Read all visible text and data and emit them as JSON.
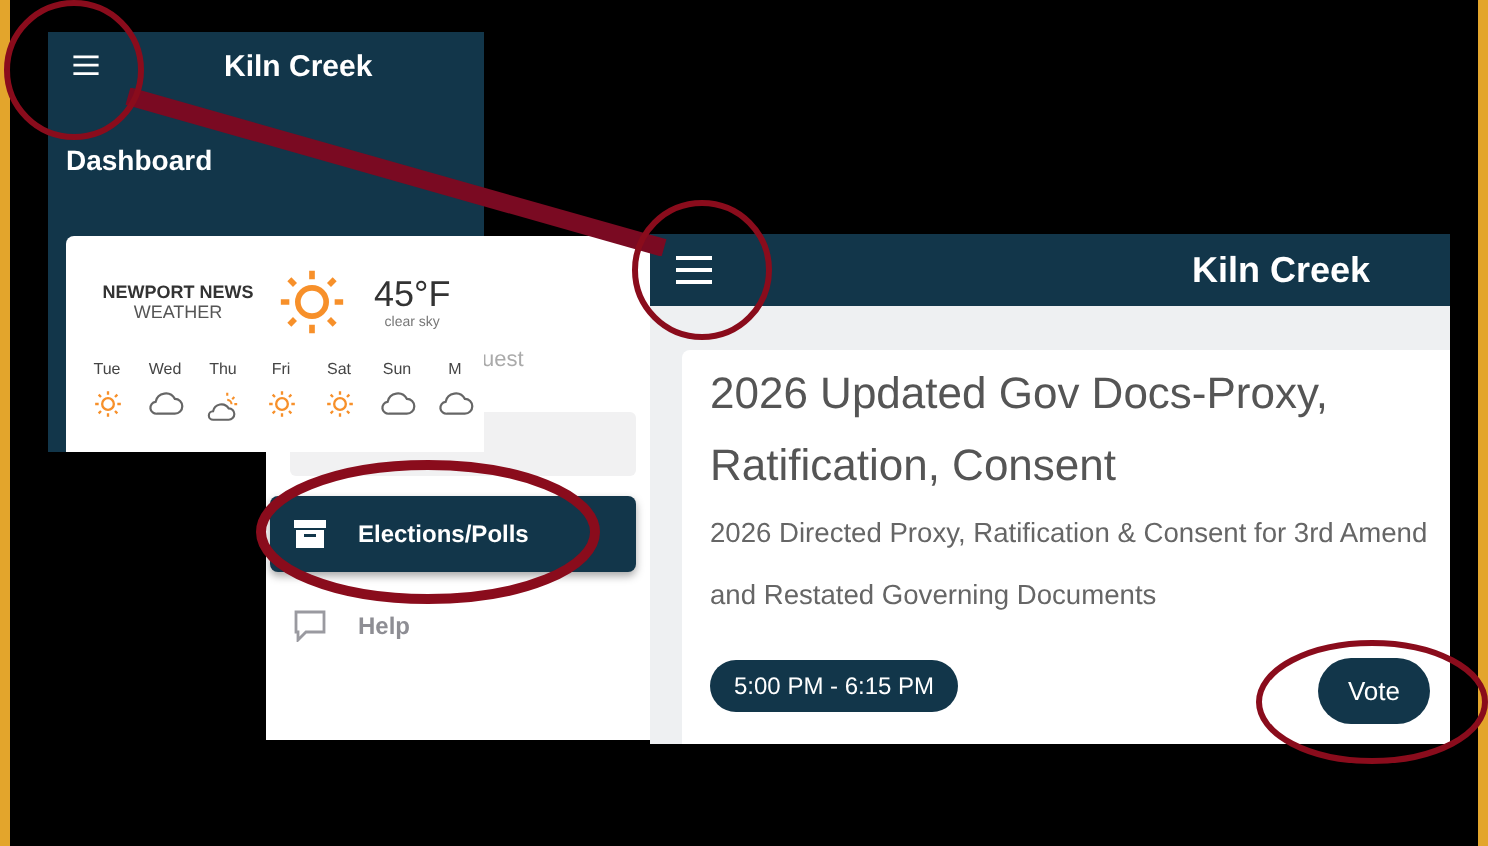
{
  "dashboard_screen": {
    "header": {
      "title": "Kiln Creek"
    },
    "section_title": "Dashboard",
    "weather": {
      "city": "NEWPORT NEWS",
      "label": "WEATHER",
      "temperature": "45°F",
      "condition": "clear sky",
      "days": [
        {
          "day": "Tue",
          "kind": "sun"
        },
        {
          "day": "Wed",
          "kind": "cloud"
        },
        {
          "day": "Thu",
          "kind": "partly"
        },
        {
          "day": "Fri",
          "kind": "sun"
        },
        {
          "day": "Sat",
          "kind": "sun"
        },
        {
          "day": "Sun",
          "kind": "cloud"
        },
        {
          "day": "M",
          "kind": "cloud"
        }
      ]
    }
  },
  "menu_screen": {
    "user_label": "uest",
    "items": [
      {
        "label": "Elections/Polls",
        "kind": "archive",
        "selected": true
      },
      {
        "label": "Help",
        "kind": "chat",
        "selected": false
      }
    ]
  },
  "poll_screen": {
    "header": {
      "title": "Kiln Creek"
    },
    "poll": {
      "title": "2026 Updated Gov Docs-Proxy, Ratification, Consent",
      "description": "2026 Directed Proxy, Ratification & Consent for 3rd Amend and Restated Governing Documents",
      "time": "5:00 PM - 6:15 PM",
      "action": "Vote"
    }
  }
}
